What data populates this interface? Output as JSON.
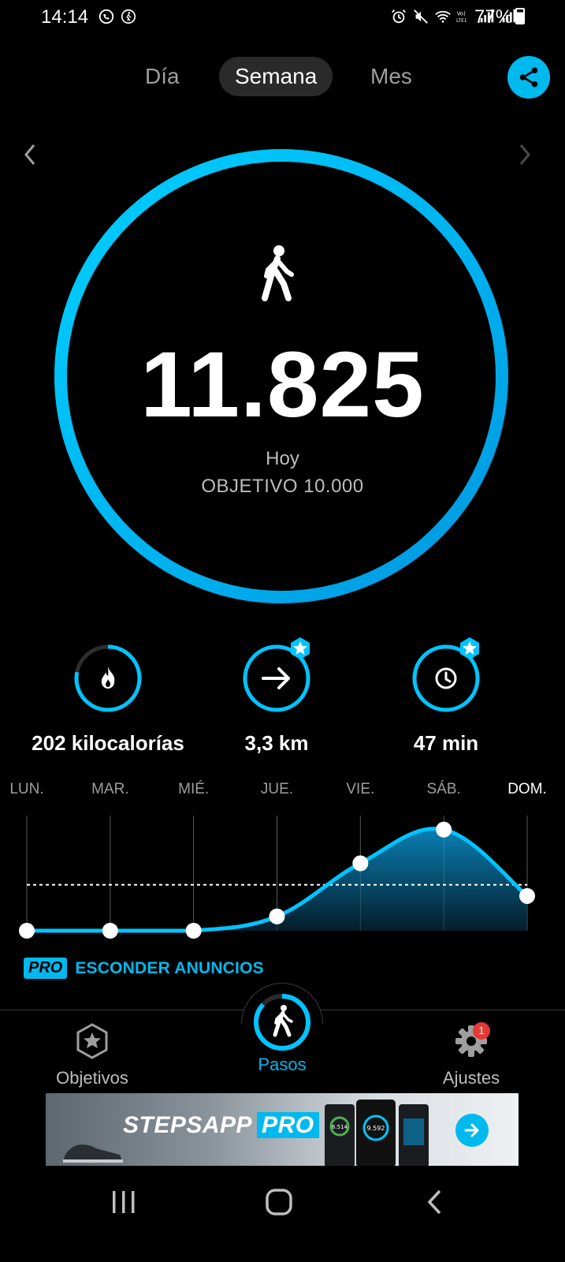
{
  "status_bar": {
    "time": "14:14",
    "battery": "77%",
    "icons": [
      "whatsapp-icon",
      "walk-notification-icon",
      "alarm-icon",
      "mute-icon",
      "wifi-icon",
      "volte-icon",
      "signal-icon",
      "battery-icon"
    ]
  },
  "tabs": [
    {
      "label": "Día",
      "active": false
    },
    {
      "label": "Semana",
      "active": true
    },
    {
      "label": "Mes",
      "active": false
    }
  ],
  "ring": {
    "steps": "11.825",
    "period": "Hoy",
    "goal": "OBJETIVO 10.000",
    "progress": 1.0,
    "accent": "#00c4ff"
  },
  "stats": [
    {
      "value": "202 kilocalorías",
      "icon": "flame-icon",
      "progress": 0.78,
      "pro": false
    },
    {
      "value": "3,3 km",
      "icon": "arrow-right-icon",
      "progress": 1.0,
      "pro": true
    },
    {
      "value": "47 min",
      "icon": "clock-icon",
      "progress": 1.0,
      "pro": true
    }
  ],
  "chart_data": {
    "type": "area",
    "categories": [
      "LUN.",
      "MAR.",
      "MIÉ.",
      "JUE.",
      "VIE.",
      "SÁB.",
      "DOM."
    ],
    "active_category": "DOM.",
    "values": [
      0,
      0,
      0,
      1400,
      6600,
      9900,
      3400
    ],
    "goal_line": 4500,
    "ylim": [
      0,
      10500
    ]
  },
  "pro": {
    "badge": "PRO",
    "label": "ESCONDER ANUNCIOS"
  },
  "bottom_nav": [
    {
      "label": "Objetivos",
      "icon": "star-badge-icon",
      "active": false
    },
    {
      "label": "Pasos",
      "icon": "walker-icon",
      "active": true
    },
    {
      "label": "Ajustes",
      "icon": "gear-icon",
      "active": false,
      "badge": "1"
    }
  ],
  "ad": {
    "brand": "STEPSAPP",
    "brand_pro": "PRO",
    "phone_steps": [
      "6.514",
      "9.592"
    ]
  },
  "colors": {
    "accent": "#00b9ee",
    "background": "#000000",
    "muted": "#9e9e9e"
  }
}
